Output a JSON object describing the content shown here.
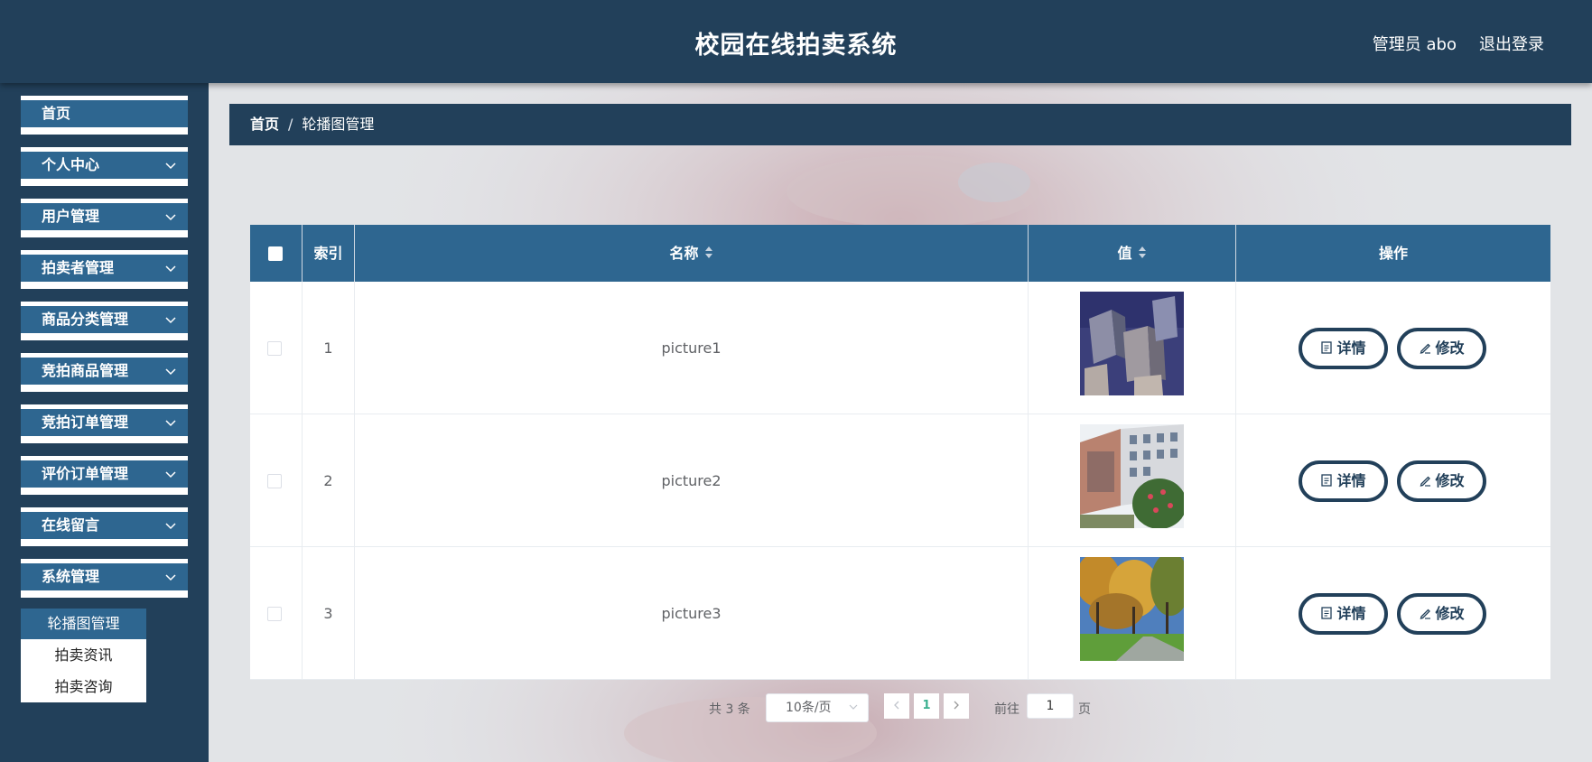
{
  "header": {
    "title": "校园在线拍卖系统",
    "user": "管理员 abo",
    "logout": "退出登录"
  },
  "sidebar": {
    "items": [
      {
        "label": "首页",
        "has_children": false
      },
      {
        "label": "个人中心",
        "has_children": true
      },
      {
        "label": "用户管理",
        "has_children": true
      },
      {
        "label": "拍卖者管理",
        "has_children": true
      },
      {
        "label": "商品分类管理",
        "has_children": true
      },
      {
        "label": "竞拍商品管理",
        "has_children": true
      },
      {
        "label": "竞拍订单管理",
        "has_children": true
      },
      {
        "label": "评价订单管理",
        "has_children": true
      },
      {
        "label": "在线留言",
        "has_children": true
      },
      {
        "label": "系统管理",
        "has_children": true
      }
    ],
    "submenu": [
      {
        "label": "轮播图管理",
        "active": true
      },
      {
        "label": "拍卖资讯",
        "active": false
      },
      {
        "label": "拍卖咨询",
        "active": false
      }
    ]
  },
  "breadcrumb": {
    "home": "首页",
    "separator": "/",
    "current": "轮播图管理"
  },
  "table": {
    "columns": {
      "index": "索引",
      "name": "名称",
      "value": "值",
      "actions": "操作"
    },
    "rows": [
      {
        "index": "1",
        "name": "picture1",
        "image": "abstract-cubes-photo"
      },
      {
        "index": "2",
        "name": "picture2",
        "image": "campus-building-photo"
      },
      {
        "index": "3",
        "name": "picture3",
        "image": "autumn-trees-photo"
      }
    ],
    "detail_label": "详情",
    "edit_label": "修改"
  },
  "pagination": {
    "total": "共 3 条",
    "page_size": "10条/页",
    "current_page": "1",
    "goto_label": "前往",
    "goto_value": "1",
    "goto_suffix": "页"
  },
  "colors": {
    "header_bg": "#22405a",
    "accent": "#2e6690",
    "active_page": "#3bb08f"
  }
}
